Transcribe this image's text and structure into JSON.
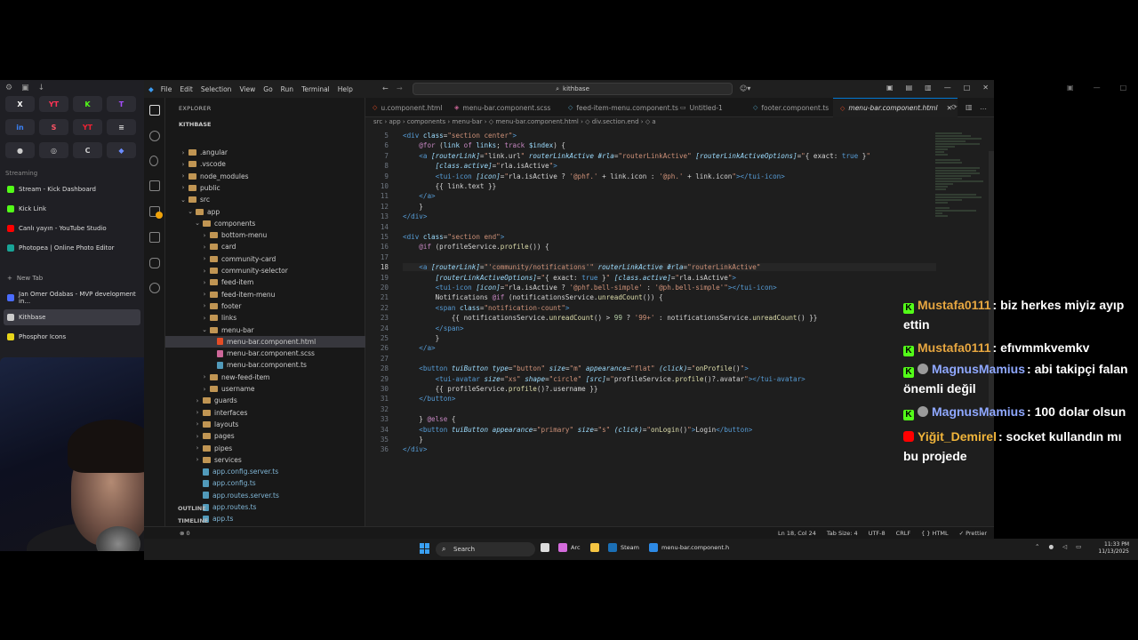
{
  "arc_sidebar": {
    "pins": [
      "X",
      "YT",
      "K",
      "T",
      "in",
      "S",
      "YT",
      "≡",
      "●",
      "◎",
      "C",
      "◆"
    ],
    "section_streaming": "Streaming",
    "tabs": [
      {
        "label": "Stream - Kick Dashboard",
        "color": "#53fc18"
      },
      {
        "label": "Kick Link",
        "color": "#53fc18"
      },
      {
        "label": "Canlı yayın - YouTube Studio",
        "color": "#ff0000"
      },
      {
        "label": "Photopea | Online Photo Editor",
        "color": "#18a497"
      }
    ],
    "new_tab": "New Tab",
    "tabs2": [
      {
        "label": "Jan Omer Odabas - MVP development in...",
        "color": "#4a6cff"
      },
      {
        "label": "Kithbase",
        "color": "#cccccc",
        "selected": true
      },
      {
        "label": "Phosphor Icons",
        "color": "#e8d51a"
      }
    ]
  },
  "vscode": {
    "menu": [
      "File",
      "Edit",
      "Selection",
      "View",
      "Go",
      "Run",
      "Terminal",
      "Help"
    ],
    "search": "kithbase",
    "explorer_title": "EXPLORER",
    "project": "KITHBASE",
    "tree": [
      {
        "label": ".angular",
        "depth": 1,
        "type": "folder",
        "chev": "›"
      },
      {
        "label": ".vscode",
        "depth": 1,
        "type": "folder",
        "chev": "›"
      },
      {
        "label": "node_modules",
        "depth": 1,
        "type": "folder",
        "chev": "›"
      },
      {
        "label": "public",
        "depth": 1,
        "type": "folder",
        "chev": "›"
      },
      {
        "label": "src",
        "depth": 1,
        "type": "folder",
        "chev": "⌄"
      },
      {
        "label": "app",
        "depth": 2,
        "type": "folder",
        "chev": "⌄"
      },
      {
        "label": "components",
        "depth": 3,
        "type": "folder",
        "chev": "⌄"
      },
      {
        "label": "bottom-menu",
        "depth": 4,
        "type": "folder",
        "chev": "›"
      },
      {
        "label": "card",
        "depth": 4,
        "type": "folder",
        "chev": "›"
      },
      {
        "label": "community-card",
        "depth": 4,
        "type": "folder",
        "chev": "›"
      },
      {
        "label": "community-selector",
        "depth": 4,
        "type": "folder",
        "chev": "›"
      },
      {
        "label": "feed-item",
        "depth": 4,
        "type": "folder",
        "chev": "›"
      },
      {
        "label": "feed-item-menu",
        "depth": 4,
        "type": "folder",
        "chev": "›"
      },
      {
        "label": "footer",
        "depth": 4,
        "type": "folder",
        "chev": "›"
      },
      {
        "label": "links",
        "depth": 4,
        "type": "folder",
        "chev": "›"
      },
      {
        "label": "menu-bar",
        "depth": 4,
        "type": "folder",
        "chev": "⌄"
      },
      {
        "label": "menu-bar.component.html",
        "depth": 5,
        "type": "html",
        "chev": "",
        "selected": true
      },
      {
        "label": "menu-bar.component.scss",
        "depth": 5,
        "type": "scss",
        "chev": ""
      },
      {
        "label": "menu-bar.component.ts",
        "depth": 5,
        "type": "ts",
        "chev": ""
      },
      {
        "label": "new-feed-item",
        "depth": 4,
        "type": "folder",
        "chev": "›"
      },
      {
        "label": "username",
        "depth": 4,
        "type": "folder",
        "chev": "›"
      },
      {
        "label": "guards",
        "depth": 3,
        "type": "folder",
        "chev": "›"
      },
      {
        "label": "interfaces",
        "depth": 3,
        "type": "folder",
        "chev": "›"
      },
      {
        "label": "layouts",
        "depth": 3,
        "type": "folder",
        "chev": "›"
      },
      {
        "label": "pages",
        "depth": 3,
        "type": "folder",
        "chev": "›"
      },
      {
        "label": "pipes",
        "depth": 3,
        "type": "folder",
        "chev": "›"
      },
      {
        "label": "services",
        "depth": 3,
        "type": "folder",
        "chev": "›"
      },
      {
        "label": "app.config.server.ts",
        "depth": 3,
        "type": "ts",
        "chev": ""
      },
      {
        "label": "app.config.ts",
        "depth": 3,
        "type": "ts",
        "chev": ""
      },
      {
        "label": "app.routes.server.ts",
        "depth": 3,
        "type": "ts",
        "chev": ""
      },
      {
        "label": "app.routes.ts",
        "depth": 3,
        "type": "ts",
        "chev": ""
      },
      {
        "label": "app.ts",
        "depth": 3,
        "type": "ts",
        "chev": ""
      }
    ],
    "outline": "OUTLINE",
    "timeline": "TIMELINE",
    "tabs": [
      {
        "label": "u.component.html",
        "icon": "◇",
        "color": "#e44d26"
      },
      {
        "label": "menu-bar.component.scss",
        "icon": "◈",
        "color": "#cd6799"
      },
      {
        "label": "feed-item-menu.component.ts",
        "icon": "◇",
        "color": "#519aba"
      },
      {
        "label": "Untitled-1",
        "icon": "▭",
        "color": "#9d9d9d"
      },
      {
        "label": "footer.component.ts",
        "icon": "◇",
        "color": "#519aba"
      },
      {
        "label": "menu-bar.component.html",
        "icon": "◇",
        "color": "#e44d26",
        "active": true
      }
    ],
    "breadcrumb": "src › app › components › menu-bar › ◇ menu-bar.component.html › ◇ div.section.end › ◇ a",
    "code_lines": [
      {
        "n": "5",
        "html": "<span class=\"tg\">&lt;div</span> <span class=\"at\">class</span>=<span class=\"st\">\"section center\"</span><span class=\"tg\">&gt;</span>"
      },
      {
        "n": "6",
        "html": "    <span class=\"kw\">@for</span> (<span class=\"at\">link</span> <span class=\"kw\">of</span> <span class=\"at\">links</span>; <span class=\"kw\">track</span> <span class=\"at\">$index</span>) {"
      },
      {
        "n": "7",
        "html": "    <span class=\"tg\">&lt;a</span> <span class=\"ita\">[routerLink]</span>=<span class=\"st\">\"</span>link.url<span class=\"st\">\"</span> <span class=\"ita\">routerLinkActive</span> <span class=\"ita\">#rla</span>=<span class=\"st\">\"routerLinkActive\"</span> <span class=\"ita\">[routerLinkActiveOptions]</span>=<span class=\"st\">\"</span>{ exact: <span class=\"tg\">true</span> }<span class=\"st\">\"</span>"
      },
      {
        "n": "8",
        "html": "        <span class=\"ita\">[class.active]</span>=<span class=\"st\">\"</span>rla.isActive<span class=\"st\">\"</span><span class=\"tg\">&gt;</span>"
      },
      {
        "n": "9",
        "html": "        <span class=\"tg\">&lt;tui-icon</span> <span class=\"ita\">[icon]</span>=<span class=\"st\">\"</span>rla.isActive ? <span class=\"st\">'@phf.'</span> + link.icon : <span class=\"st\">'@ph.'</span> + link.icon<span class=\"st\">\"</span><span class=\"tg\">&gt;&lt;/tui-icon&gt;</span>"
      },
      {
        "n": "10",
        "html": "        {{ link.text }}"
      },
      {
        "n": "11",
        "html": "    <span class=\"tg\">&lt;/a&gt;</span>"
      },
      {
        "n": "12",
        "html": "    }"
      },
      {
        "n": "13",
        "html": "<span class=\"tg\">&lt;/div&gt;</span>"
      },
      {
        "n": "14",
        "html": ""
      },
      {
        "n": "15",
        "html": "<span class=\"tg\">&lt;div</span> <span class=\"at\">class</span>=<span class=\"st\">\"section end\"</span><span class=\"tg\">&gt;</span>"
      },
      {
        "n": "16",
        "html": "    <span class=\"kw\">@if</span> (profileService.<span class=\"ka\">profile</span>()) {"
      },
      {
        "n": "17",
        "html": ""
      },
      {
        "n": "18",
        "html": "    <span class=\"tg\">&lt;a</span> <span class=\"ita\">[routerLink]</span>=<span class=\"st\">\"'community/notifications'\"</span> <span class=\"ita\">routerLinkActive</span> <span class=\"ita\">#rla</span>=<span class=\"st\">\"routerLinkActive\"</span>",
        "cur": true
      },
      {
        "n": "19",
        "html": "        <span class=\"ita\">[routerLinkActiveOptions]</span>=<span class=\"st\">\"</span>{ exact: <span class=\"tg\">true</span> }<span class=\"st\">\"</span> <span class=\"ita\">[class.active]</span>=<span class=\"st\">\"</span>rla.isActive<span class=\"st\">\"</span><span class=\"tg\">&gt;</span>"
      },
      {
        "n": "20",
        "html": "        <span class=\"tg\">&lt;tui-icon</span> <span class=\"ita\">[icon]</span>=<span class=\"st\">\"</span>rla.isActive ? <span class=\"st\">'@phf.bell-simple'</span> : <span class=\"st\">'@ph.bell-simple'</span><span class=\"st\">\"</span><span class=\"tg\">&gt;&lt;/tui-icon&gt;</span>"
      },
      {
        "n": "21",
        "html": "        Notifications <span class=\"kw\">@if</span> (notificationsService.<span class=\"ka\">unreadCount</span>()) {"
      },
      {
        "n": "22",
        "html": "        <span class=\"tg\">&lt;span</span> <span class=\"at\">class</span>=<span class=\"st\">\"notification-count\"</span><span class=\"tg\">&gt;</span>"
      },
      {
        "n": "23",
        "html": "            {{ notificationsService.<span class=\"ka\">unreadCount</span>() &gt; <span class=\"nm\">99</span> ? <span class=\"st\">'99+'</span> : notificationsService.<span class=\"ka\">unreadCount</span>() }}"
      },
      {
        "n": "24",
        "html": "        <span class=\"tg\">&lt;/span&gt;</span>"
      },
      {
        "n": "25",
        "html": "        }"
      },
      {
        "n": "26",
        "html": "    <span class=\"tg\">&lt;/a&gt;</span>"
      },
      {
        "n": "27",
        "html": ""
      },
      {
        "n": "28",
        "html": "    <span class=\"tg\">&lt;button</span> <span class=\"ita\">tuiButton</span> <span class=\"ita\">type</span>=<span class=\"st\">\"button\"</span> <span class=\"ita\">size</span>=<span class=\"st\">\"m\"</span> <span class=\"ita\">appearance</span>=<span class=\"st\">\"flat\"</span> <span class=\"ita\">(click)</span>=<span class=\"st\">\"</span><span class=\"ka\">onProfile</span>()<span class=\"st\">\"</span><span class=\"tg\">&gt;</span>"
      },
      {
        "n": "29",
        "html": "        <span class=\"tg\">&lt;tui-avatar</span> <span class=\"ita\">size</span>=<span class=\"st\">\"xs\"</span> <span class=\"ita\">shape</span>=<span class=\"st\">\"circle\"</span> <span class=\"ita\">[src]</span>=<span class=\"st\">\"</span>profileService.<span class=\"ka\">profile</span>()?.avatar<span class=\"st\">\"</span><span class=\"tg\">&gt;&lt;/tui-avatar&gt;</span>"
      },
      {
        "n": "30",
        "html": "        {{ profileService.<span class=\"ka\">profile</span>()?.username }}"
      },
      {
        "n": "31",
        "html": "    <span class=\"tg\">&lt;/button&gt;</span>"
      },
      {
        "n": "32",
        "html": ""
      },
      {
        "n": "33",
        "html": "    } <span class=\"kw\">@else</span> {"
      },
      {
        "n": "34",
        "html": "    <span class=\"tg\">&lt;button</span> <span class=\"ita\">tuiButton</span> <span class=\"ita\">appearance</span>=<span class=\"st\">\"primary\"</span> <span class=\"ita\">size</span>=<span class=\"st\">\"s\"</span> <span class=\"ita\">(click)</span>=<span class=\"st\">\"</span><span class=\"ka\">onLogin</span>()<span class=\"st\">\"</span><span class=\"tg\">&gt;</span>Login<span class=\"tg\">&lt;/button&gt;</span>"
      },
      {
        "n": "35",
        "html": "    }"
      },
      {
        "n": "36",
        "html": "<span class=\"tg\">&lt;/div&gt;</span>"
      }
    ],
    "status_left": "⊗ 0",
    "status_right": [
      "Ln 18, Col 24",
      "Tab Size: 4",
      "UTF-8",
      "CRLF",
      "{ } HTML",
      "✓ Prettier"
    ]
  },
  "chat": [
    {
      "badge": "k",
      "avatar": false,
      "user": "Mustafa0111",
      "user_color": "#e6a640",
      "text": "biz herkes miyiz ayıp ettin"
    },
    {
      "badge": "k",
      "avatar": false,
      "user": "Mustafa0111",
      "user_color": "#e6a640",
      "text": "efıvmmkvemkv"
    },
    {
      "badge": "k",
      "avatar": true,
      "user": "MagnusMamius",
      "user_color": "#8fa8ff",
      "text": "abi takipçi falan önemli değil"
    },
    {
      "badge": "k",
      "avatar": true,
      "user": "MagnusMamius",
      "user_color": "#8fa8ff",
      "text": "100 dolar olsun"
    },
    {
      "badge": "y",
      "avatar": false,
      "user": "Yiğit_Demirel",
      "user_color": "#f0b43a",
      "text": "socket kullandın mı bu projede"
    }
  ],
  "taskbar": {
    "search": "Search",
    "items": [
      "Arc",
      "Steam",
      "menu-bar.component.h"
    ],
    "time": "11:33 PM",
    "date": "11/13/2025"
  }
}
